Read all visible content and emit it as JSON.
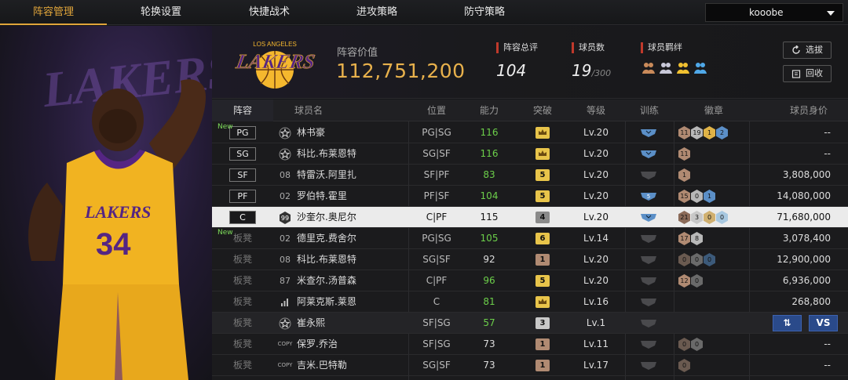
{
  "nav": {
    "tabs": [
      "阵容管理",
      "轮换设置",
      "快捷战术",
      "进攻策略",
      "防守策略"
    ],
    "active_tab": 0,
    "user": "kooobe"
  },
  "header": {
    "team_logo_text": "LAKERS",
    "team_logo_subtext": "LOS ANGELES",
    "value_label": "阵容价值",
    "value": "112,751,200",
    "stats": [
      {
        "label": "阵容总评",
        "value": "104"
      },
      {
        "label": "球员数",
        "value": "19",
        "suffix": "/300"
      },
      {
        "label": "球员羁绊"
      }
    ],
    "buttons": {
      "select": "选拔",
      "recycle": "回收"
    }
  },
  "table": {
    "columns": [
      "阵容",
      "球员名",
      "位置",
      "能力",
      "突破",
      "等级",
      "训练",
      "徽章",
      "球员身价"
    ],
    "rows": [
      {
        "slot": "PG",
        "new": "New",
        "jersey": "☆",
        "name": "林书豪",
        "pos": "PG|SG",
        "ability": "116",
        "ability_color": "#6ccf4a",
        "break": "crown",
        "break_color": "#e8c44a",
        "level": "Lv.20",
        "train": "blue",
        "badges": [
          {
            "t": "11",
            "c": "#b08a72"
          },
          {
            "t": "19",
            "c": "#b8b8b8"
          },
          {
            "t": "1",
            "c": "#e0b347"
          },
          {
            "t": "2",
            "c": "#5b8fc7"
          }
        ],
        "price": "--"
      },
      {
        "slot": "SG",
        "jersey": "☆",
        "name": "科比.布莱恩特",
        "pos": "SG|SF",
        "ability": "116",
        "ability_color": "#6ccf4a",
        "break": "crown",
        "break_color": "#e8c44a",
        "level": "Lv.20",
        "train": "blue",
        "badges": [
          {
            "t": "11",
            "c": "#b08a72"
          }
        ],
        "price": "--"
      },
      {
        "slot": "SF",
        "jersey": "08",
        "name": "特雷沃.阿里扎",
        "pos": "SF|PF",
        "ability": "83",
        "ability_color": "#6ccf4a",
        "break": "5",
        "break_color": "#e8c44a",
        "level": "Lv.20",
        "train": "gray",
        "badges": [
          {
            "t": "1",
            "c": "#b08a72"
          }
        ],
        "price": "3,808,000"
      },
      {
        "slot": "PF",
        "jersey": "02",
        "name": "罗伯特.霍里",
        "pos": "PF|SF",
        "ability": "104",
        "ability_color": "#6ccf4a",
        "break": "5",
        "break_color": "#e8c44a",
        "level": "Lv.20",
        "train": "blue5",
        "badges": [
          {
            "t": "15",
            "c": "#b08a72"
          },
          {
            "t": "0",
            "c": "#b8b8b8"
          },
          {
            "t": "1",
            "c": "#5b8fc7"
          }
        ],
        "price": "14,080,000"
      },
      {
        "slot": "C",
        "jersey": "99",
        "name": "沙奎尔.奥尼尔",
        "pos": "C|PF",
        "ability": "115",
        "ability_color": "#111111",
        "break": "4",
        "break_color": "#8a8a8a",
        "level": "Lv.20",
        "train": "blue",
        "badges": [
          {
            "t": "21",
            "c": "#8a6a58"
          },
          {
            "t": "3",
            "c": "#c8c8c8"
          },
          {
            "t": "0",
            "c": "#d0b070"
          },
          {
            "t": "0",
            "c": "#a8c8e0"
          }
        ],
        "price": "71,680,000",
        "highlight": true
      },
      {
        "slot": "板凳",
        "new": "New",
        "jersey": "02",
        "name": "德里克.费舍尔",
        "pos": "PG|SG",
        "ability": "105",
        "ability_color": "#6ccf4a",
        "break": "6",
        "break_color": "#e8c44a",
        "level": "Lv.14",
        "train": "gray",
        "badges": [
          {
            "t": "17",
            "c": "#b08a72"
          },
          {
            "t": "8",
            "c": "#b8b8b8"
          }
        ],
        "price": "3,078,400"
      },
      {
        "slot": "板凳",
        "jersey": "08",
        "name": "科比.布莱恩特",
        "pos": "SG|SF",
        "ability": "92",
        "ability_color": "#dddddd",
        "break": "1",
        "break_color": "#b08a72",
        "level": "Lv.20",
        "train": "gray",
        "badges": [
          {
            "t": "0",
            "c": "#6a5a50"
          },
          {
            "t": "0",
            "c": "#6a6a6a"
          },
          {
            "t": "0",
            "c": "#3c5a7a"
          }
        ],
        "price": "12,900,000"
      },
      {
        "slot": "板凳",
        "jersey": "87",
        "name": "米查尔.汤普森",
        "pos": "C|PF",
        "ability": "96",
        "ability_color": "#6ccf4a",
        "break": "5",
        "break_color": "#e8c44a",
        "level": "Lv.20",
        "train": "gray",
        "badges": [
          {
            "t": "12",
            "c": "#b08a72"
          },
          {
            "t": "0",
            "c": "#6a6a6a"
          }
        ],
        "price": "6,936,000"
      },
      {
        "slot": "板凳",
        "jersey": "bars",
        "name": "阿莱克斯.莱恩",
        "pos": "C",
        "ability": "81",
        "ability_color": "#6ccf4a",
        "break": "crown",
        "break_color": "#e8c44a",
        "level": "Lv.16",
        "train": "gray",
        "badges": [],
        "price": "268,800"
      },
      {
        "slot": "板凳",
        "jersey": "☆",
        "name": "崔永熙",
        "pos": "SF|SG",
        "ability": "57",
        "ability_color": "#6ccf4a",
        "break": "3",
        "break_color": "#c8c8c8",
        "level": "Lv.1",
        "train": "gray",
        "badges": [],
        "price": "",
        "dim": true,
        "actions": [
          "⇅",
          "VS"
        ]
      },
      {
        "slot": "板凳",
        "jersey": "COPY",
        "name": "保罗.乔治",
        "pos": "SF|SG",
        "ability": "73",
        "ability_color": "#dddddd",
        "break": "1",
        "break_color": "#b08a72",
        "level": "Lv.11",
        "train": "gray",
        "badges": [
          {
            "t": "0",
            "c": "#6a5a50"
          },
          {
            "t": "0",
            "c": "#6a6a6a"
          }
        ],
        "price": "--"
      },
      {
        "slot": "板凳",
        "jersey": "COPY",
        "name": "吉米.巴特勒",
        "pos": "SG|SF",
        "ability": "73",
        "ability_color": "#dddddd",
        "break": "1",
        "break_color": "#b08a72",
        "level": "Lv.17",
        "train": "gray",
        "badges": [
          {
            "t": "0",
            "c": "#6a5a50"
          }
        ],
        "price": "--"
      }
    ]
  },
  "colors": {
    "accent": "#e0a53a",
    "lakers_gold": "#f5b82e",
    "lakers_purple": "#552583",
    "green": "#6ccf4a"
  }
}
